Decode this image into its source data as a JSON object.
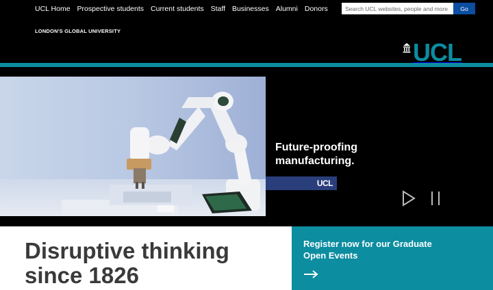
{
  "topnav": {
    "links": [
      "UCL Home",
      "Prospective students",
      "Current students",
      "Staff",
      "Businesses",
      "Alumni",
      "Donors"
    ]
  },
  "search": {
    "placeholder": "Search UCL websites, people and more",
    "button_label": "Go"
  },
  "header": {
    "tagline": "LONDON'S GLOBAL UNIVERSITY",
    "logo_text": "UCL",
    "logo_icon": "portico-icon"
  },
  "hero": {
    "image_subject": "robot-arm-photo",
    "caption_lines": [
      "Future-proofing",
      "manufacturing."
    ],
    "tag_text": "UCL",
    "controls": {
      "play": "play-icon",
      "pause": "pause-icon"
    }
  },
  "intro": {
    "headline_lines": [
      "Disruptive thinking",
      "since 1826"
    ]
  },
  "promo": {
    "lines": [
      "Register now for our Graduate",
      "Open Events"
    ],
    "arrow": "arrow-right-icon"
  },
  "colors": {
    "brand_teal": "#0c8da0",
    "search_button_blue": "#0b4ea2",
    "background": "#000000",
    "headline_gray": "#3a3a3a"
  }
}
